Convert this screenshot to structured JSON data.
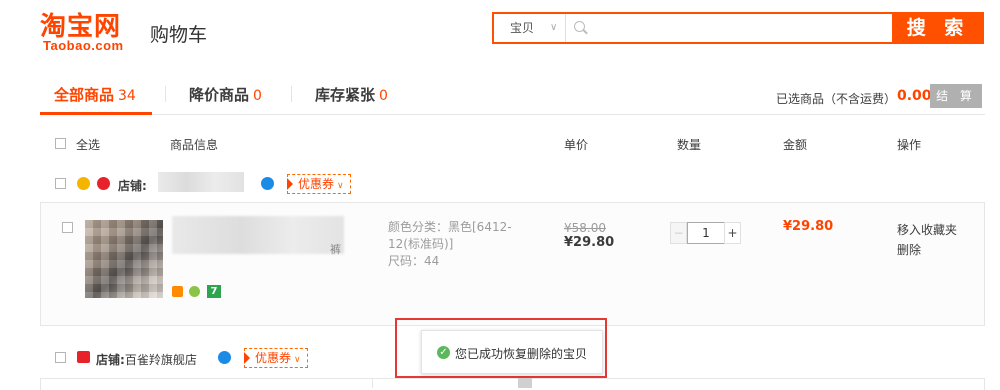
{
  "header": {
    "logo_cn": "淘宝网",
    "logo_en": "Taobao.com",
    "page_title": "购物车",
    "search": {
      "category": "宝贝",
      "placeholder": "",
      "button_label": "搜 索"
    }
  },
  "tabs": [
    {
      "label": "全部商品",
      "count": "34"
    },
    {
      "label": "降价商品",
      "count": "0"
    },
    {
      "label": "库存紧张",
      "count": "0"
    }
  ],
  "summary": {
    "label": "已选商品（不含运费）",
    "amount": "0.00",
    "checkout_label": "结 算"
  },
  "columns": {
    "select_all": "全选",
    "info": "商品信息",
    "unit_price": "单价",
    "quantity": "数量",
    "amount": "金额",
    "actions": "操作"
  },
  "shops": [
    {
      "label": "店铺:",
      "name": "",
      "coupon": "优惠券"
    },
    {
      "label": "店铺:",
      "name": "百雀羚旗舰店",
      "coupon": "优惠券"
    }
  ],
  "item": {
    "title_tail": "裤",
    "props": [
      "颜色分类：黑色[6412-",
      "12(标准码)]",
      "尺码：44"
    ],
    "price_old": "¥58.00",
    "price_now": "¥29.80",
    "quantity": "1",
    "amount": "¥29.80",
    "actions": [
      "移入收藏夹",
      "删除"
    ]
  },
  "toast": {
    "message": "您已成功恢复删除的宝贝"
  },
  "colors": {
    "brand": "#ff4400",
    "search_border": "#ff5000",
    "success": "#5cb85c",
    "annotation_frame": "#e53935"
  }
}
